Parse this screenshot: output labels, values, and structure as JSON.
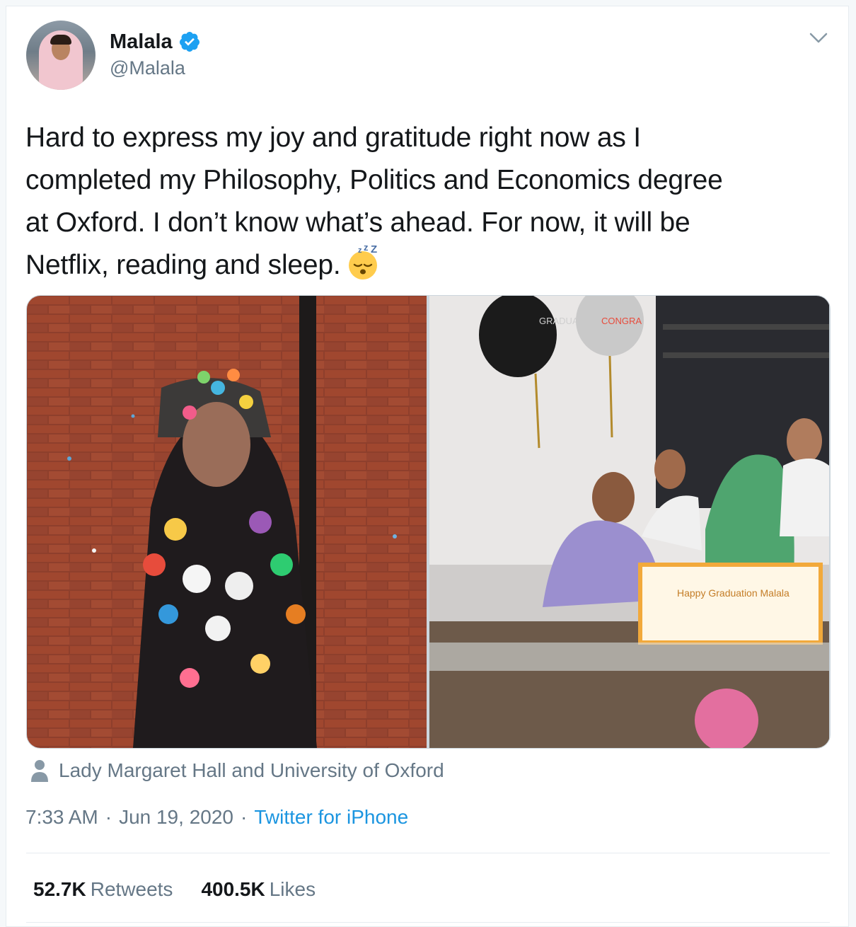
{
  "author": {
    "name": "Malala",
    "handle": "@Malala",
    "verified": true,
    "avatar_icon": "profile-photo"
  },
  "tweet": {
    "text": "Hard to express my joy and gratitude right now as I\ncompleted my Philosophy, Politics and Economics degree\nat Oxford. I don’t know what’s ahead. For now, it will be\nNetflix, reading and sleep.",
    "emoji": "sleeping-face-emoji"
  },
  "media": {
    "photos": [
      {
        "icon": "photo-graduation-trashing"
      },
      {
        "icon": "photo-family-cake-celebration"
      }
    ],
    "cake_text": "Happy Graduation Malala",
    "balloon_text_1": "GRADUATION",
    "balloon_text_2": "CONGRA"
  },
  "location": {
    "icon": "person-icon",
    "text": "Lady Margaret Hall and University of Oxford"
  },
  "meta": {
    "time": "7:33 AM",
    "separator": "·",
    "date": "Jun 19, 2020",
    "source": "Twitter for iPhone"
  },
  "stats": {
    "retweets_count": "52.7K",
    "retweets_label": "Retweets",
    "likes_count": "400.5K",
    "likes_label": "Likes"
  },
  "colors": {
    "link": "#1b95e0",
    "secondary_text": "#657786",
    "verified": "#1da1f2"
  }
}
